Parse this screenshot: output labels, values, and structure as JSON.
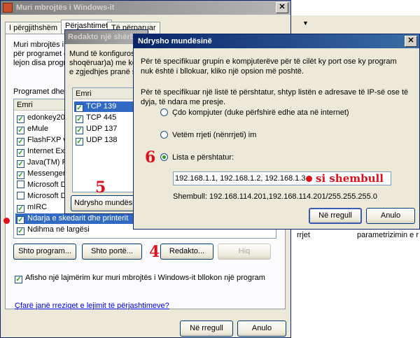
{
  "main_window": {
    "title": "Muri mbrojtës i Windows-it",
    "tabs": [
      "I përgjithshëm",
      "Përjashtimet",
      "Të përparuar"
    ],
    "intro": "Muri mbrojtës i Windows-it po bllokon lidhjet hyrëse, me përjashtim të programeve dhe shërbimeve të përzgjedhura më poshtë. Shtimi i përjashtimeve lejon disa programe",
    "intro_line1": "Muri mbrojtës i V",
    "intro_line2": "për programet d",
    "intro_line3": "lejon disa progr",
    "programs_label": "Programet dhe s",
    "column": "Emri",
    "programs": [
      {
        "label": "edonkey2000",
        "checked": true
      },
      {
        "label": "eMule",
        "checked": true
      },
      {
        "label": "FlashFXP v",
        "checked": true
      },
      {
        "label": "Internet Ex",
        "checked": true
      },
      {
        "label": "Java(TM) P",
        "checked": true
      },
      {
        "label": "Messenger",
        "checked": true
      },
      {
        "label": "Microsoft D",
        "checked": false
      },
      {
        "label": "Microsoft D",
        "checked": false
      },
      {
        "label": "mIRC",
        "checked": true
      },
      {
        "label": "Ndarja e skedarit dhe printerit",
        "checked": true
      },
      {
        "label": "Ndihma në largësi",
        "checked": true
      }
    ],
    "buttons": {
      "add_program": "Shto program...",
      "add_port": "Shto portë...",
      "edit": "Redakto...",
      "delete": "Hiq",
      "ok": "Në rregull",
      "cancel": "Anulo"
    },
    "notify_label": "Afisho një lajmërim kur muri mbrojtës i Windows-it bllokon një program",
    "notify_checked": true,
    "risk_link": "Çfarë janë rreziqet e lejimit të përjashtimeve?"
  },
  "edit_window": {
    "title": "Redakto një shërbim",
    "text_line1": "Mund të konfigurosh",
    "text_line2": "shoqëruar)a) me këtë",
    "text_line3": "e zgjedhjes pranë sa",
    "column": "Emri",
    "ports": [
      {
        "label": "TCP 139",
        "checked": true
      },
      {
        "label": "TCP 445",
        "checked": true
      },
      {
        "label": "UDP 137",
        "checked": true
      },
      {
        "label": "UDP 138",
        "checked": true
      }
    ],
    "change_scope_button": "Ndrysho mundësinë"
  },
  "scope_dialog": {
    "title": "Ndrysho mundësinë",
    "para1": "Për të specifikuar grupin e kompjuterëve për të cilët ky port ose ky program nuk është i bllokuar, kliko një opsion më poshtë.",
    "para2": "Për të specifikuar një listë të përshtatur, shtyp listën e adresave të IP-së ose të dyja, të ndara me presje.",
    "options": [
      {
        "label": "Çdo kompjuter (duke përfshirë edhe ata në internet)",
        "selected": false
      },
      {
        "label": "Vetëm rrjeti (nënrrjeti) im",
        "selected": false
      },
      {
        "label": "Lista e përshtatur:",
        "selected": true
      }
    ],
    "custom_list_value": "192.168.1.1, 192.168.1.2, 192.168.1.3",
    "example": "Shembull: 192.168.114.201,192.168.114.201/255.255.255.0",
    "ok": "Në rregull",
    "cancel": "Anulo"
  },
  "background": {
    "text_a": "rrjet",
    "text_b": "parametrizimin e r"
  },
  "annotations": {
    "step4": "4",
    "step5": "5",
    "step6": "6",
    "example_tag": "si shembull"
  },
  "colors": {
    "titlebar": "#0a246a",
    "annotation_red": "#e0101a",
    "check_green": "#21a121"
  }
}
